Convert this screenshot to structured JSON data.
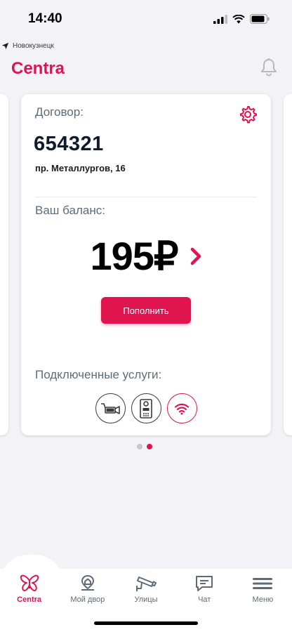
{
  "status": {
    "time": "14:40"
  },
  "location": {
    "city": "Новокузнецк"
  },
  "header": {
    "brand": "Centra"
  },
  "contract": {
    "label": "Договор:",
    "number": "654321",
    "address": "пр. Металлургов, 16"
  },
  "balance": {
    "label": "Ваш баланс:",
    "amount": "195₽",
    "topup_label": "Пополнить"
  },
  "services": {
    "label": "Подключенные услуги:",
    "items": [
      {
        "icon": "camera-icon",
        "active": false
      },
      {
        "icon": "intercom-icon",
        "active": false
      },
      {
        "icon": "wifi-icon",
        "active": true
      }
    ]
  },
  "pager": {
    "count": 2,
    "active_index": 1
  },
  "tabs": [
    {
      "label": "Centra",
      "icon": "butterfly-icon",
      "active": true
    },
    {
      "label": "Мой двор",
      "icon": "yard-icon",
      "active": false
    },
    {
      "label": "Улицы",
      "icon": "street-camera-icon",
      "active": false
    },
    {
      "label": "Чат",
      "icon": "chat-icon",
      "active": false
    },
    {
      "label": "Меню",
      "icon": "menu-icon",
      "active": false
    }
  ],
  "colors": {
    "accent": "#e0144f",
    "background": "#f2f2f7",
    "muted_text": "#5e6b76"
  }
}
